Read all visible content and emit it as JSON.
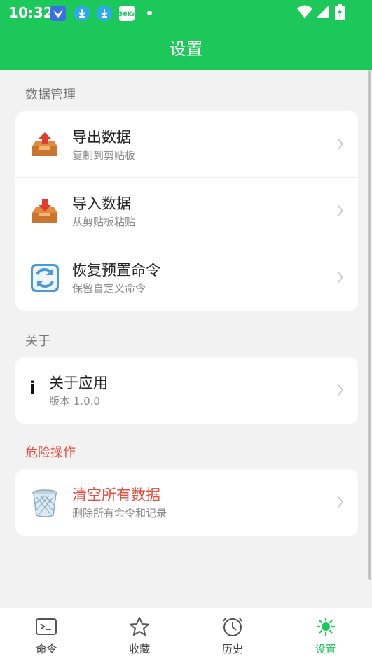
{
  "status_bar": {
    "time": "10:32",
    "notification_icons": [
      "bird-app-icon",
      "download-icon",
      "download-icon",
      "36kr-icon"
    ],
    "kr_badge": "36Kr"
  },
  "header": {
    "title": "设置"
  },
  "sections": {
    "data": {
      "label": "数据管理",
      "items": [
        {
          "title": "导出数据",
          "subtitle": "复制到剪贴板",
          "icon": "export-tray-icon"
        },
        {
          "title": "导入数据",
          "subtitle": "从剪贴板粘贴",
          "icon": "import-tray-icon"
        },
        {
          "title": "恢复预置命令",
          "subtitle": "保留自定义命令",
          "icon": "restore-arrows-icon"
        }
      ]
    },
    "about": {
      "label": "关于",
      "items": [
        {
          "title": "关于应用",
          "subtitle": "版本 1.0.0",
          "icon": "info-icon",
          "icon_glyph": "i"
        }
      ]
    },
    "danger": {
      "label": "危险操作",
      "items": [
        {
          "title": "清空所有数据",
          "subtitle": "删除所有命令和记录",
          "icon": "trash-basket-icon"
        }
      ]
    }
  },
  "bottom_nav": [
    {
      "label": "命令",
      "icon": "terminal-icon"
    },
    {
      "label": "收藏",
      "icon": "star-icon"
    },
    {
      "label": "历史",
      "icon": "clock-icon"
    },
    {
      "label": "设置",
      "icon": "sun-icon",
      "active": true
    }
  ],
  "colors": {
    "primary": "#1dc85a",
    "danger": "#e74c3c",
    "background": "#f2f2f2",
    "card": "#ffffff"
  }
}
